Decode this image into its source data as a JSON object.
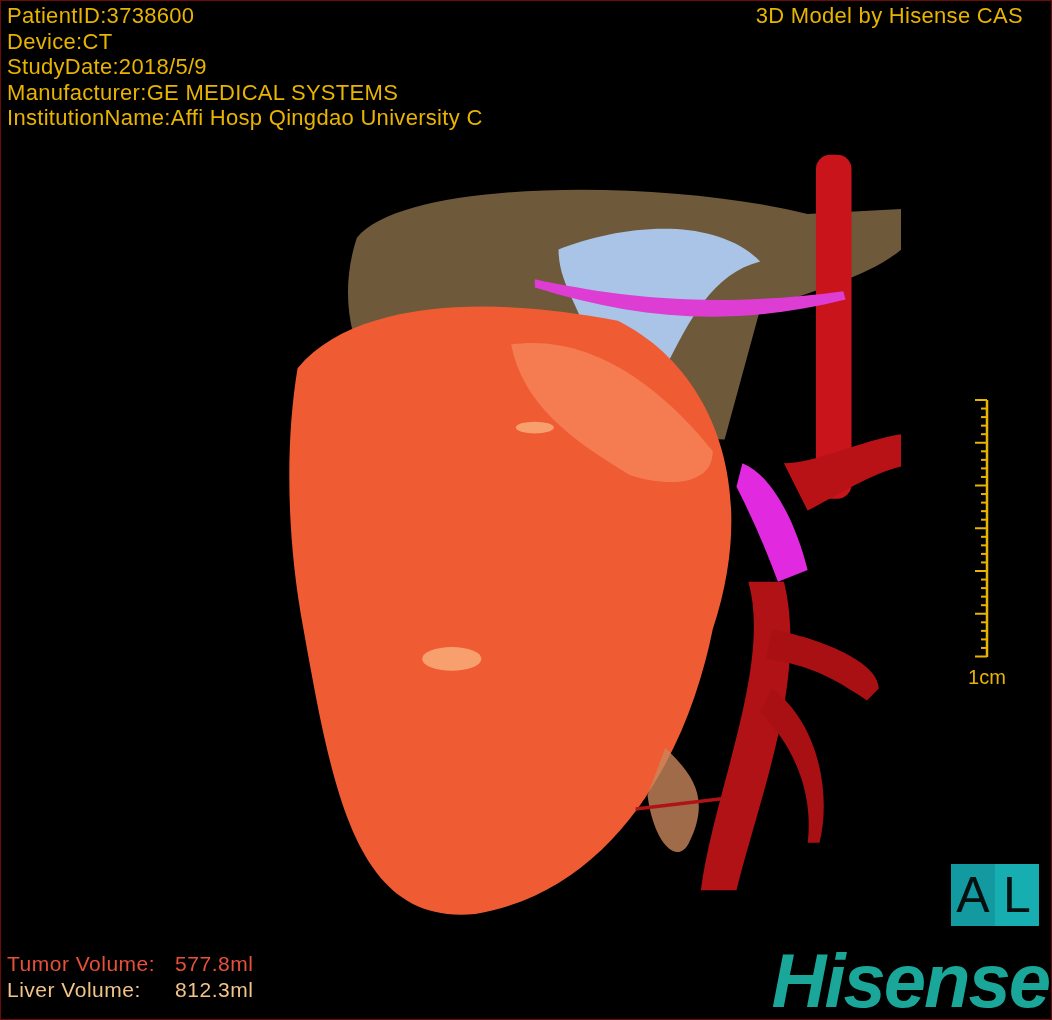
{
  "header": {
    "info_lines": [
      "PatientID:3738600",
      "Device:CT",
      "StudyDate:2018/5/9",
      "Manufacturer:GE MEDICAL SYSTEMS",
      "InstitutionName:Affi Hosp Qingdao University C"
    ],
    "credit": "3D Model by Hisense CAS"
  },
  "scale": {
    "label": "1cm"
  },
  "orientation": [
    "A",
    "L"
  ],
  "volumes": [
    {
      "label": "Tumor Volume:",
      "value": "577.8ml",
      "color": "#e8503a"
    },
    {
      "label": "Liver Volume:",
      "value": "812.3ml",
      "color": "#f2c48a"
    }
  ],
  "logo": "Hisense"
}
